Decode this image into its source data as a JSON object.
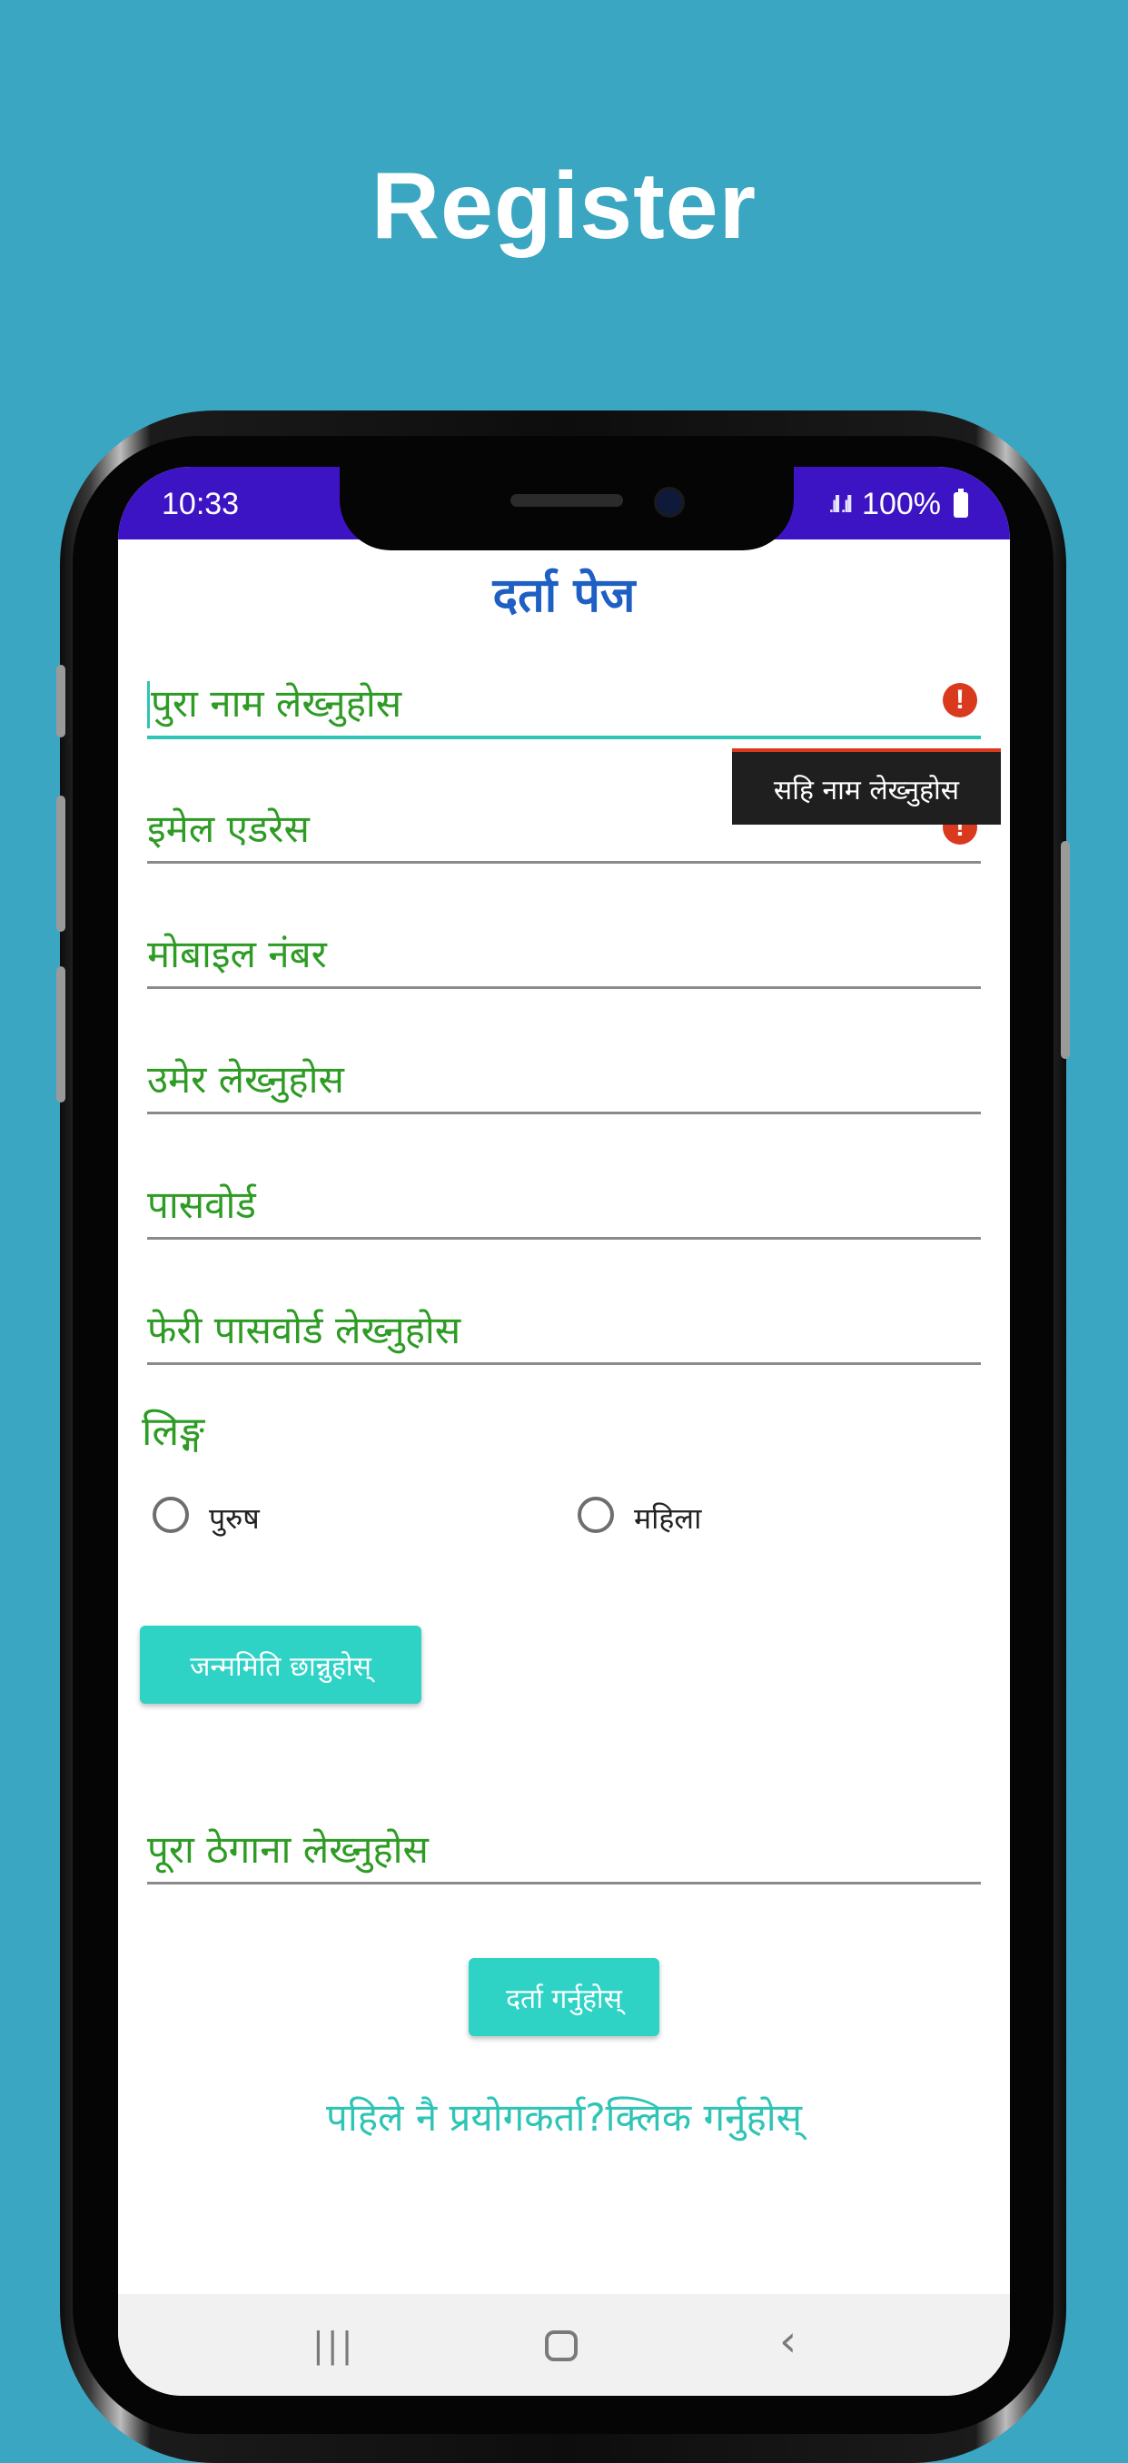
{
  "headline": "Register",
  "status_bar": {
    "time": "10:33",
    "signal": ".ıll .ıll",
    "battery": "100%",
    "battery_icon": "battery-icon"
  },
  "form": {
    "title": "दर्ता पेज",
    "fields": [
      {
        "placeholder": "पुरा नाम लेख्नुहोस",
        "error": true
      },
      {
        "placeholder": "इमेल एडरेस",
        "error": true
      },
      {
        "placeholder": "मोबाइल नंबर"
      },
      {
        "placeholder": "उमेर लेख्नुहोस"
      },
      {
        "placeholder": "पासवोर्ड"
      },
      {
        "placeholder": "फेरी पासवोर्ड लेख्नुहोस"
      }
    ],
    "error_icon": "!",
    "error_tooltip": "सहि नाम लेख्नुहोस",
    "gender_label": "लिङ्ग",
    "gender_options": [
      "पुरुष",
      "महिला"
    ],
    "dob_button": "जन्ममिति छान्नुहोस्",
    "address_placeholder": "पूरा ठेगाना लेख्नुहोस",
    "submit_button": "दर्ता गर्नुहोस्",
    "login_link": "पहिले नै प्रयोगकर्ता?क्लिक गर्नुहोस्"
  },
  "navbar": {
    "recent": "|||",
    "back": "‹"
  },
  "colors": {
    "background": "#3aa6c2",
    "status_bar": "#3d14c4",
    "accent": "#2ec4b6",
    "field_text": "#2e9b24",
    "title": "#1e5fc4",
    "error": "#d9391c"
  }
}
